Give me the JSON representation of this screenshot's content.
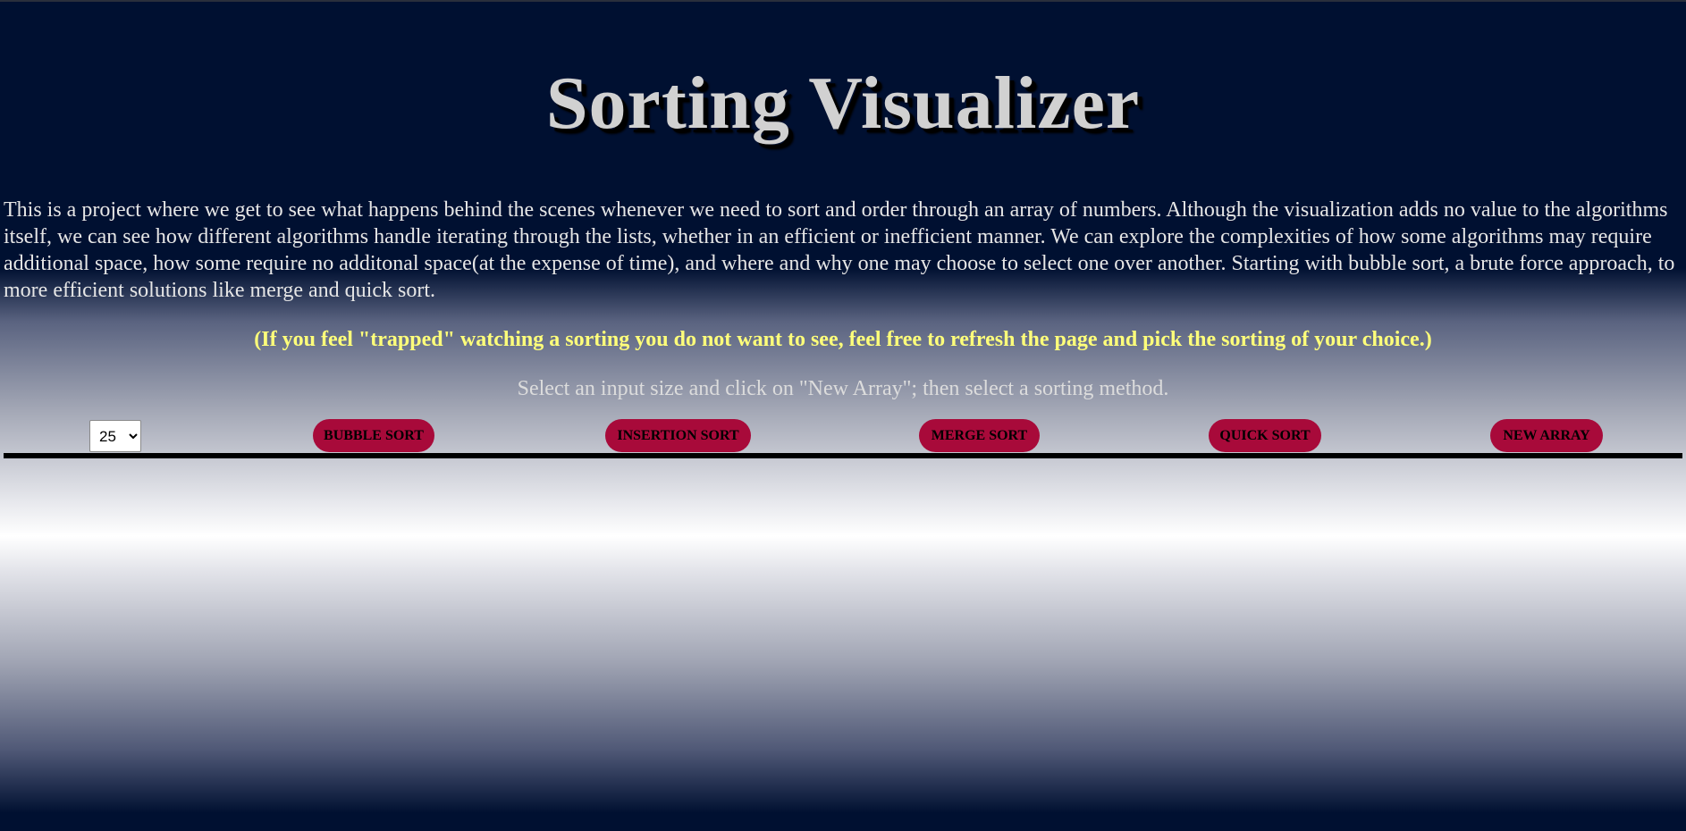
{
  "header": {
    "title": "Sorting Visualizer"
  },
  "intro": {
    "text": "This is a project where we get to see what happens behind the scenes whenever we need to sort and order through an array of numbers. Although the visualization adds no value to the algorithms itself, we can see how different algorithms handle iterating through the lists, whether in an efficient or inefficient manner. We can explore the complexities of how some algorithms may require additional space, how some require no additonal space(at the expense of time), and where and why one may choose to select one over another. Starting with bubble sort, a brute force approach, to more efficient solutions like merge and quick sort."
  },
  "warning": {
    "text": "(If you feel \"trapped\" watching a sorting you do not want to see, feel free to refresh the page and pick the sorting of your choice.)"
  },
  "instruction": {
    "text": "Select an input size and click on \"New Array\"; then select a sorting method."
  },
  "controls": {
    "input_size": {
      "selected": "25"
    },
    "buttons": {
      "bubble": "BUBBLE SORT",
      "insertion": "INSERTION SORT",
      "merge": "MERGE SORT",
      "quick": "QUICK SORT",
      "new_array": "NEW ARRAY"
    }
  },
  "colors": {
    "background_dark": "#001031",
    "background_light": "#ffffff",
    "title": "#d1d1d1",
    "warning": "#ffff7a",
    "button": "#a80a3a",
    "baseline": "#000000"
  }
}
